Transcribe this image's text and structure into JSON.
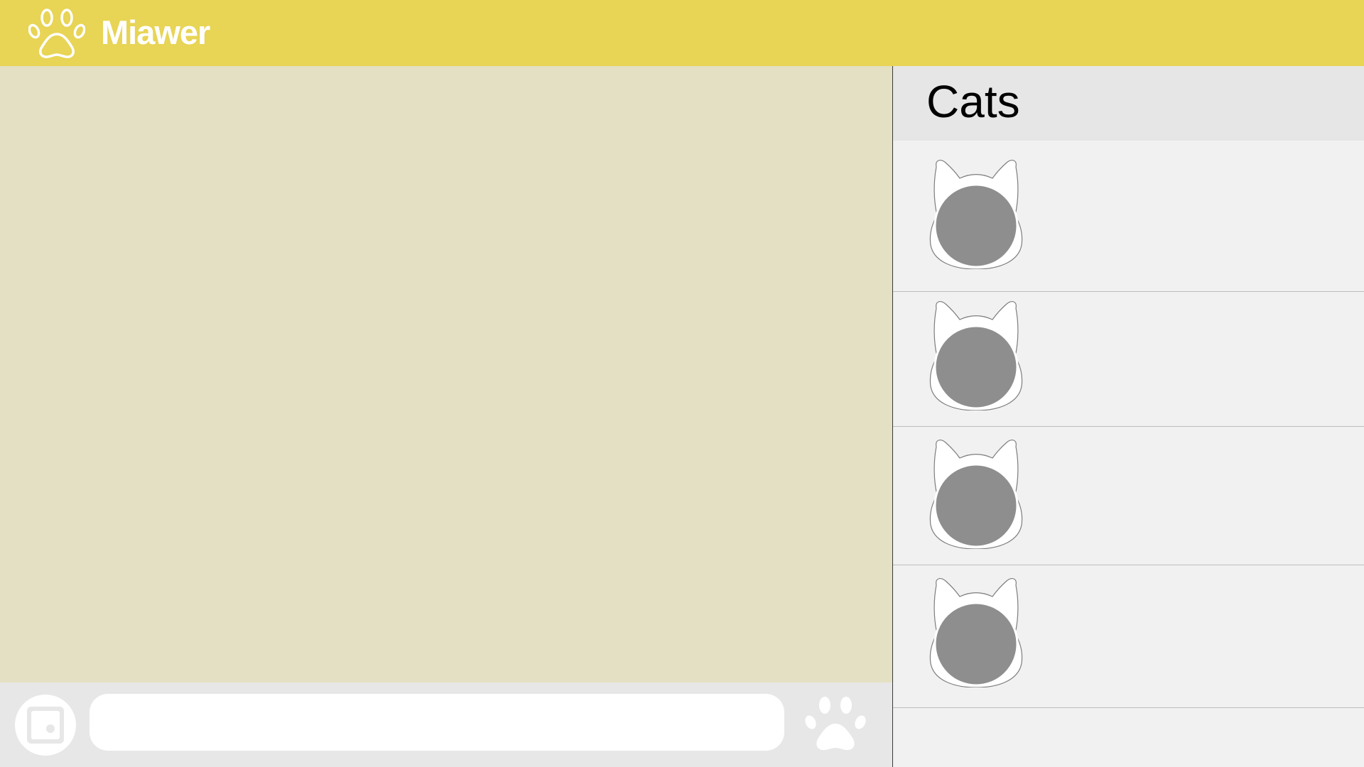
{
  "app": {
    "title": "Miawer",
    "logo_icon": "paw-icon"
  },
  "colors": {
    "header": "#e8d455",
    "chat_background": "#e4e0c3",
    "sidebar_background": "#f1f1f1",
    "sidebar_header": "#e6e6e6",
    "composer_background": "#e7e7e7",
    "avatar_fill": "#8e8e8e"
  },
  "sidebar": {
    "title": "Cats",
    "cats": [
      {
        "name": "",
        "avatar_icon": "cat-head-icon"
      },
      {
        "name": "",
        "avatar_icon": "cat-head-icon"
      },
      {
        "name": "",
        "avatar_icon": "cat-head-icon"
      },
      {
        "name": "",
        "avatar_icon": "cat-head-icon"
      }
    ]
  },
  "composer": {
    "photo_icon": "photo-icon",
    "message_value": "",
    "message_placeholder": "",
    "send_icon": "paw-icon"
  }
}
